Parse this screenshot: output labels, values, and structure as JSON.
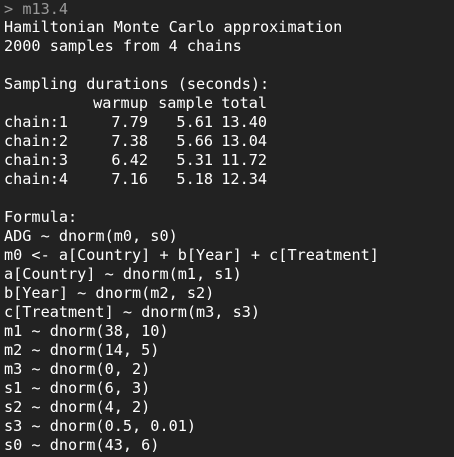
{
  "prompt": {
    "symbol": ">",
    "command": "m13.4"
  },
  "header": {
    "line1": "Hamiltonian Monte Carlo approximation",
    "line2": "2000 samples from 4 chains"
  },
  "durations": {
    "title": "Sampling durations (seconds):",
    "columns": [
      "",
      "warmup",
      "sample",
      "total"
    ],
    "rows": [
      [
        "chain:1",
        "7.79",
        "5.61",
        "13.40"
      ],
      [
        "chain:2",
        "7.38",
        "5.66",
        "13.04"
      ],
      [
        "chain:3",
        "6.42",
        "5.31",
        "11.72"
      ],
      [
        "chain:4",
        "7.16",
        "5.18",
        "12.34"
      ]
    ]
  },
  "formula": {
    "title": "Formula:",
    "lines": [
      "ADG ~ dnorm(m0, s0)",
      "m0 <- a[Country] + b[Year] + c[Treatment]",
      "a[Country] ~ dnorm(m1, s1)",
      "b[Year] ~ dnorm(m2, s2)",
      "c[Treatment] ~ dnorm(m3, s3)",
      "m1 ~ dnorm(38, 10)",
      "m2 ~ dnorm(14, 5)",
      "m3 ~ dnorm(0, 2)",
      "s1 ~ dnorm(6, 3)",
      "s2 ~ dnorm(4, 2)",
      "s3 ~ dnorm(0.5, 0.01)",
      "s0 ~ dnorm(43, 6)"
    ]
  },
  "colors": {
    "background": "#222222",
    "text": "#ffffff",
    "prompt": "#9a9a9a"
  }
}
